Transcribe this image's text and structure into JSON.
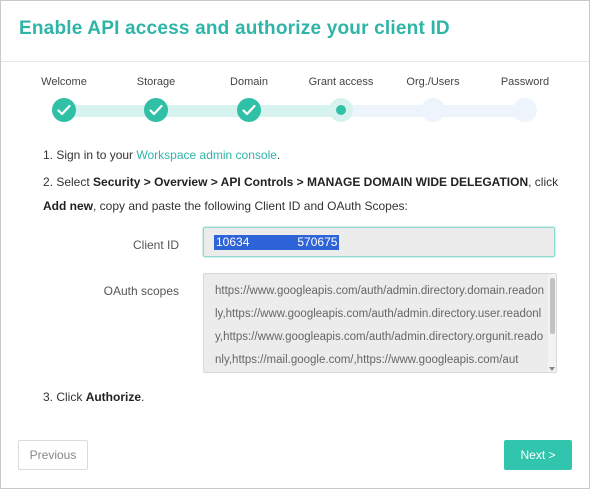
{
  "title": "Enable API access and authorize your client ID",
  "steps": [
    {
      "label": "Welcome",
      "state": "done"
    },
    {
      "label": "Storage",
      "state": "done"
    },
    {
      "label": "Domain",
      "state": "done"
    },
    {
      "label": "Grant access",
      "state": "current"
    },
    {
      "label": "Org./Users",
      "state": "todo"
    },
    {
      "label": "Password",
      "state": "todo"
    }
  ],
  "instructions": {
    "step1_prefix": "1. Sign in to your ",
    "step1_link": "Workspace admin console",
    "step1_suffix": ".",
    "step2_prefix": "2. Select ",
    "step2_path": "Security > Overview > API Controls > MANAGE DOMAIN WIDE DELEGATION",
    "step2_middle": ", click ",
    "step2_action": "Add new",
    "step2_suffix": ", copy and paste the following Client ID and OAuth Scopes:",
    "step3_prefix": "3. Click ",
    "step3_action": "Authorize",
    "step3_suffix": "."
  },
  "client_id": {
    "label": "Client ID",
    "value_start": "10634",
    "value_end": "570675"
  },
  "oauth_scopes": {
    "label": "OAuth scopes",
    "value": "https://www.googleapis.com/auth/admin.directory.domain.readonly,https://www.googleapis.com/auth/admin.directory.user.readonly,https://www.googleapis.com/auth/admin.directory.orgunit.readonly,https://mail.google.com/,https://www.googleapis.com/aut"
  },
  "buttons": {
    "previous": "Previous",
    "next": "Next >"
  },
  "colors": {
    "accent": "#2fc0a6",
    "title": "#2fb5a8",
    "selection": "#2f63d8"
  }
}
